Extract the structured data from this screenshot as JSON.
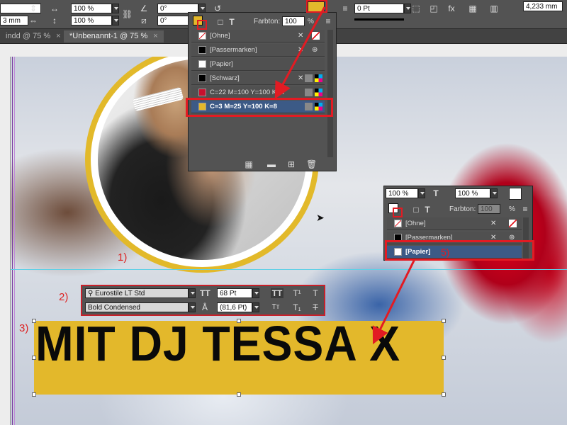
{
  "control_bar": {
    "scale_x": "100 %",
    "scale_y": "100 %",
    "rotate": "0°",
    "shear": "0°",
    "stroke_weight": "0 Pt",
    "dimension": "4,233 mm",
    "left_value": "3 mm"
  },
  "tabs": [
    {
      "label": "indd @ 75 %",
      "active": false
    },
    {
      "label": "*Unbenannt-1 @ 75 %",
      "active": true
    }
  ],
  "swatch_panel_top": {
    "tint_label": "Farbton:",
    "tint_value": "100",
    "tint_unit": "%",
    "swatches": [
      {
        "name": "[Ohne]",
        "color": "#ffffff"
      },
      {
        "name": "[Passermarken]",
        "color": "#000000"
      },
      {
        "name": "[Papier]",
        "color": "#ffffff"
      },
      {
        "name": "[Schwarz]",
        "color": "#000000"
      },
      {
        "name": "C=22 M=100 Y=100 K=4",
        "color": "#c8102e"
      },
      {
        "name": "C=3 M=25 Y=100 K=8",
        "color": "#e3b82b"
      }
    ]
  },
  "swatch_panel_bottom": {
    "scale_x": "100 %",
    "scale_y": "100 %",
    "tint_label": "Farbton:",
    "tint_value": "100",
    "tint_unit": "%",
    "swatches": [
      {
        "name": "[Ohne]",
        "color": "#ffffff"
      },
      {
        "name": "[Passermarken]",
        "color": "#000000"
      },
      {
        "name": "[Papier]",
        "color": "#ffffff"
      }
    ],
    "callout_number": "5)"
  },
  "character_controls": {
    "font_family": "Eurostile LT Std",
    "font_style": "Bold Condensed",
    "font_size": "68 Pt",
    "leading": "(81,6 Pt)"
  },
  "callouts": {
    "one": "1)",
    "two": "2)",
    "three": "3)"
  },
  "headline": "MIT DJ TESSA X",
  "colors": {
    "accent_red": "#e21b23",
    "yellow": "#e3b82b",
    "panel": "#535353"
  }
}
